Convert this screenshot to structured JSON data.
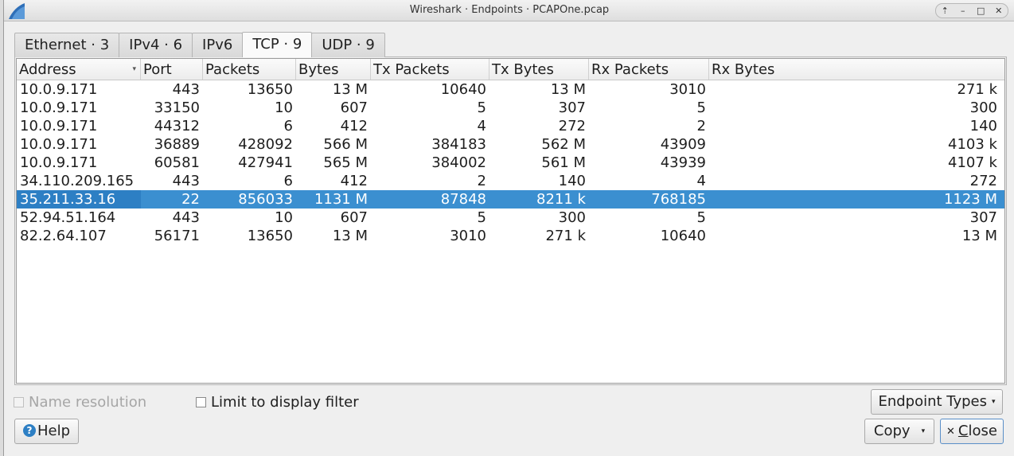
{
  "window": {
    "title": "Wireshark · Endpoints · PCAPOne.pcap",
    "controls": [
      "⇡",
      "–",
      "□",
      "✕"
    ]
  },
  "tabs": [
    {
      "label": "Ethernet · 3"
    },
    {
      "label": "IPv4 · 6"
    },
    {
      "label": "IPv6"
    },
    {
      "label": "TCP · 9"
    },
    {
      "label": "UDP · 9"
    }
  ],
  "table": {
    "columns": [
      "Address",
      "Port",
      "Packets",
      "Bytes",
      "Tx Packets",
      "Tx Bytes",
      "Rx Packets",
      "Rx Bytes"
    ],
    "sort_indicator": "▾",
    "rows": [
      [
        "10.0.9.171",
        "443",
        "13650",
        "13 M",
        "10640",
        "13 M",
        "3010",
        "271 k"
      ],
      [
        "10.0.9.171",
        "33150",
        "10",
        "607",
        "5",
        "307",
        "5",
        "300"
      ],
      [
        "10.0.9.171",
        "44312",
        "6",
        "412",
        "4",
        "272",
        "2",
        "140"
      ],
      [
        "10.0.9.171",
        "36889",
        "428092",
        "566 M",
        "384183",
        "562 M",
        "43909",
        "4103 k"
      ],
      [
        "10.0.9.171",
        "60581",
        "427941",
        "565 M",
        "384002",
        "561 M",
        "43939",
        "4107 k"
      ],
      [
        "34.110.209.165",
        "443",
        "6",
        "412",
        "2",
        "140",
        "4",
        "272"
      ],
      [
        "35.211.33.16",
        "22",
        "856033",
        "1131 M",
        "87848",
        "8211 k",
        "768185",
        "1123 M"
      ],
      [
        "52.94.51.164",
        "443",
        "10",
        "607",
        "5",
        "300",
        "5",
        "307"
      ],
      [
        "82.2.64.107",
        "56171",
        "13650",
        "13 M",
        "3010",
        "271 k",
        "10640",
        "13 M"
      ]
    ],
    "selected_row": 6
  },
  "footer": {
    "name_resolution_label": "Name resolution",
    "limit_filter_label": "Limit to display filter",
    "endpoint_types_label": "Endpoint Types",
    "help_label": "Help",
    "copy_label": "Copy",
    "close_label_first": "C",
    "close_label_rest": "lose"
  },
  "colors": {
    "selection": "#3b8fd0",
    "accent": "#2d7fc4"
  }
}
